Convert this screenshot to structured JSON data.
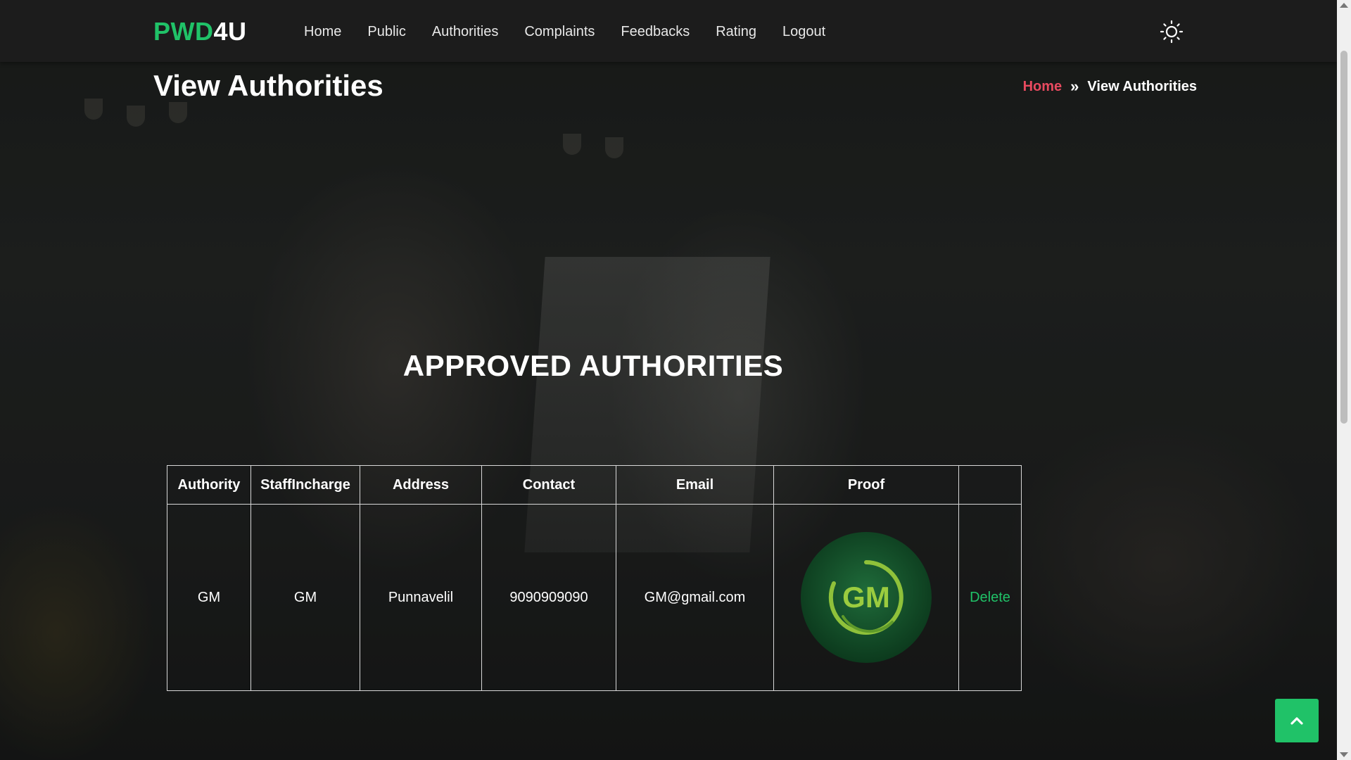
{
  "brand": {
    "logo_part_a": "PWD",
    "logo_part_b": "4U",
    "accent": "#20c268",
    "link_red": "#e84a5f"
  },
  "nav": {
    "items": [
      {
        "label": "Home"
      },
      {
        "label": "Public"
      },
      {
        "label": "Authorities"
      },
      {
        "label": "Complaints"
      },
      {
        "label": "Feedbacks"
      },
      {
        "label": "Rating"
      },
      {
        "label": "Logout"
      }
    ],
    "theme_icon": "sun-icon"
  },
  "header": {
    "title": "View Authorities",
    "breadcrumb": {
      "home": "Home",
      "separator": "»",
      "current": "View Authorities"
    }
  },
  "section": {
    "title": "APPROVED AUTHORITIES"
  },
  "table": {
    "columns": [
      "Authority",
      "StaffIncharge",
      "Address",
      "Contact",
      "Email",
      "Proof",
      ""
    ],
    "rows": [
      {
        "authority": "GM",
        "staff_incharge": "GM",
        "address": "Punnavelil",
        "contact": "9090909090",
        "email": "GM@gmail.com",
        "proof_logo_text": "GM",
        "action": "Delete"
      }
    ]
  },
  "back_to_top_icon": "chevron-up-icon"
}
